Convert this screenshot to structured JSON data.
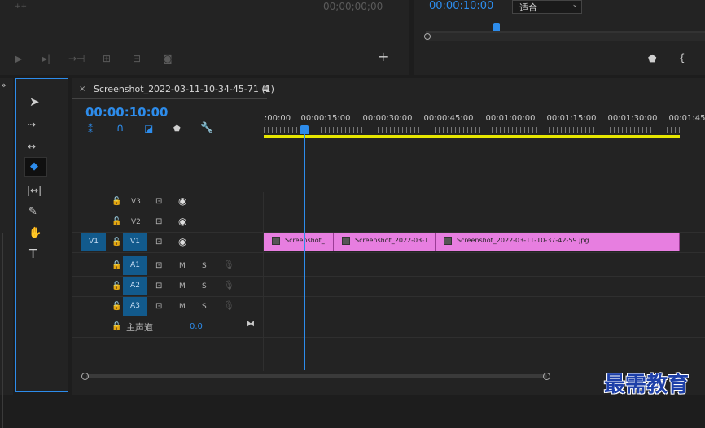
{
  "source_monitor": {
    "timecode": "00;00;00;00"
  },
  "program_monitor": {
    "timecode": "00:00:10:00",
    "zoom": "适合"
  },
  "sequence": {
    "close": "×",
    "name": "Screenshot_2022-03-11-10-34-45-71 (1)",
    "menu": "≡",
    "timecode": "00:00:10:00"
  },
  "ruler": {
    "labels": [
      ":00:00",
      "00:00:15:00",
      "00:00:30:00",
      "00:00:45:00",
      "00:01:00:00",
      "00:01:15:00",
      "00:01:30:00",
      "00:01:45"
    ]
  },
  "tracks": {
    "v3": "V3",
    "v2": "V2",
    "v1_source": "V1",
    "v1": "V1",
    "a1": "A1",
    "a2": "A2",
    "a3": "A3",
    "m": "M",
    "s": "S",
    "master_label": "主声道",
    "master_value": "0.0"
  },
  "clips": [
    {
      "name": "Screenshot_"
    },
    {
      "name": "Screenshot_2022-03-1"
    },
    {
      "name": "Screenshot_2022-03-11-10-37-42-59.jpg"
    }
  ],
  "watermark": "最需教育",
  "icons": [
    "play-icon",
    "step-forward-icon",
    "insert-icon",
    "lift-icon",
    "extract-icon",
    "camera-icon",
    "plus-icon",
    "marker-icon",
    "selection-tool-icon",
    "track-select-tool-icon",
    "ripple-edit-tool-icon",
    "razor-tool-icon",
    "slip-tool-icon",
    "pen-tool-icon",
    "hand-tool-icon",
    "type-tool-icon",
    "wrench-icon",
    "eye-icon",
    "lock-icon",
    "mic-icon"
  ],
  "colors": {
    "accent": "#2d8ceb",
    "clip": "#e77ee0",
    "work_area": "#e6e600"
  }
}
